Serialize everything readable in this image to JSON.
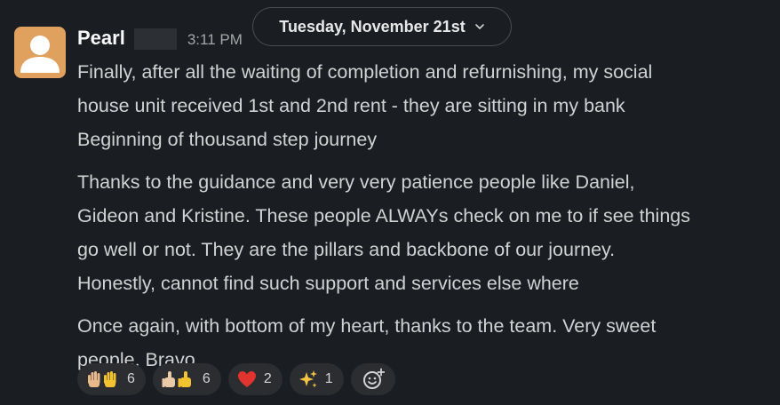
{
  "date_divider": {
    "label": "Tuesday, November 21st"
  },
  "message": {
    "author": "Pearl",
    "timestamp": "3:11 PM",
    "paragraphs": [
      {
        "lines": [
          "Finally, after all the waiting of completion and refurnishing, my social",
          "house unit received 1st and 2nd rent - they are sitting in my bank",
          "Beginning of thousand step journey"
        ]
      },
      {
        "lines": [
          "Thanks to the guidance and very very patience people like Daniel,",
          "Gideon and Kristine.  These people ALWAYs check on me to if see things",
          "go well or not. They are the pillars and backbone of our journey.",
          "Honestly, cannot find such support and services else where"
        ]
      },
      {
        "lines": [
          "Once again, with bottom of my heart, thanks to the team. Very sweet",
          "people. Bravo"
        ]
      }
    ],
    "reactions": [
      {
        "icon": "raised-hands-icon",
        "count": "6"
      },
      {
        "icon": "thumbs-up-icon",
        "count": "6"
      },
      {
        "icon": "red-heart-icon",
        "count": "2"
      },
      {
        "icon": "sparkles-icon",
        "count": "1"
      }
    ]
  },
  "colors": {
    "background": "#1a1d21",
    "avatar": "#e0a15e",
    "reaction_bg": "#2b2d31",
    "text": "#d1d2d3"
  }
}
